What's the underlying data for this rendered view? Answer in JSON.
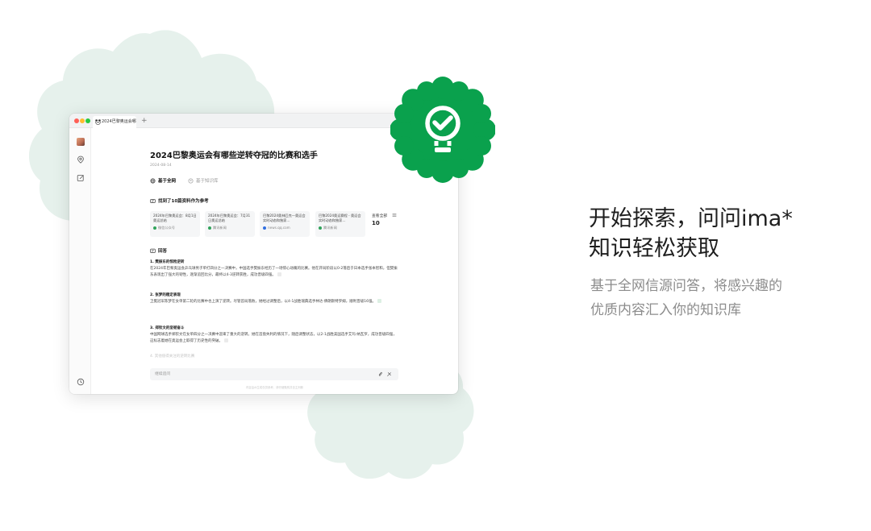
{
  "window": {
    "tab_title": "2024巴黎奥运会哪",
    "new_tab": "+"
  },
  "question": {
    "title": "2024巴黎奥运会有哪些逆转夺冠的比赛和选手",
    "date": "2024-08-14"
  },
  "modes": [
    {
      "label": "基于全网",
      "active": true
    },
    {
      "label": "基于知识库",
      "active": false
    }
  ],
  "references": {
    "found_label": "找到了10篇资料作为参考",
    "cards": [
      {
        "title": "2024年巴黎奥运会：8月1日奥运总结",
        "source": "微信公众号",
        "source_color": "#2fa35a"
      },
      {
        "title": "2024年巴黎奥运会：7月31日奥运总结",
        "source": "腾讯新闻",
        "source_color": "#2fa35a"
      },
      {
        "title": "巴黎2024奥林匹克—奥运会实时动态和独家…",
        "source": "news.qq.com",
        "source_color": "#2f6fe0"
      },
      {
        "title": "巴黎2024奥运赛程 - 奥运会实时动态和独家…",
        "source": "腾讯新闻",
        "source_color": "#2fa35a"
      }
    ],
    "view_all_label": "查看全部",
    "view_all_count": "10"
  },
  "answer": {
    "heading": "回答",
    "sections": [
      {
        "title": "1. 樊振东的惊险逆转",
        "body": "在2024年巴黎奥运会乒乓球男子单打四分之一决赛中，中国选手樊振东经历了一场惊心动魄的比赛。他在开局阶段以0-2落后于日本选手张本智和，但樊振东表现出了强大的韧性，逐渐追回比分，最终以4-3逆转获胜，成功晋级四强。"
      },
      {
        "title": "2. 张梦的稳定表现",
        "body": "卫冕冠军陈梦在女单第二轮的比赛中也上演了逆转。尽管首局落败，她经过调整后，以4-1战胜瑞典选手林达·佛朗斯特罗姆，顺利晋级16强。"
      },
      {
        "title": "3. 郑钦文的坚韧奋斗",
        "body": "中国网球选手郑钦文在女单四分之一决赛中迎来了重大的逆转。她在首盘失利的情况下，随后调整状态，以2-1战胜美国选手艾玛·纳瓦罗，成功晋级四强，这标志着她在奥运会上取得了历史性的突破。"
      }
    ],
    "faded_line": "4. 其他值得关注的逆转比赛"
  },
  "input": {
    "placeholder": "继续追问"
  },
  "disclaimer": "内容由AI生成仅供参考，请仔细甄别并自主判断",
  "hero": {
    "title_lines": [
      "开始探索，问问ima*",
      "知识轻松获取"
    ],
    "subtitle_lines": [
      "基于全网信源问答，将感兴趣的",
      "优质内容汇入你的知识库"
    ]
  },
  "colors": {
    "brand_green": "#0aa14d",
    "blob_green": "#e6f1ec"
  },
  "icons": [
    "lightbulb-icon",
    "location-pin-icon",
    "edit-icon",
    "history-icon",
    "globe-icon",
    "book-icon",
    "sparkle-icon",
    "answer-icon",
    "paperclip-icon",
    "tools-icon",
    "panda-logo-icon"
  ]
}
